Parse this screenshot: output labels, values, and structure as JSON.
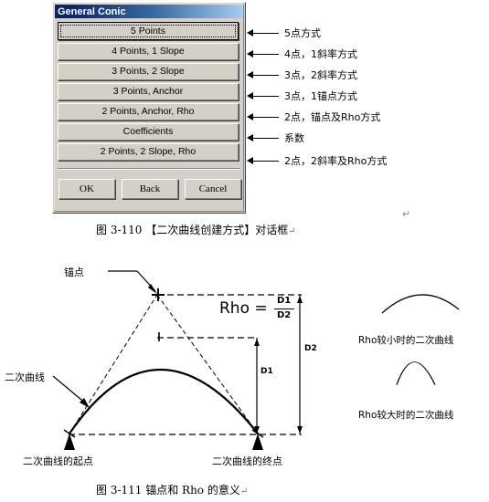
{
  "dialog": {
    "title": "General Conic",
    "options": [
      {
        "label": "5 Points",
        "selected": true
      },
      {
        "label": "4 Points, 1 Slope",
        "selected": false
      },
      {
        "label": "3 Points, 2 Slope",
        "selected": false
      },
      {
        "label": "3 Points, Anchor",
        "selected": false
      },
      {
        "label": "2 Points, Anchor, Rho",
        "selected": false
      },
      {
        "label": "Coefficients",
        "selected": false
      },
      {
        "label": "2 Points, 2 Slope, Rho",
        "selected": false
      }
    ],
    "actions": [
      {
        "label": "OK"
      },
      {
        "label": "Back"
      },
      {
        "label": "Cancel"
      }
    ]
  },
  "annotations": [
    {
      "text": "5点方式"
    },
    {
      "text": "4点，1斜率方式"
    },
    {
      "text": "3点，2斜率方式"
    },
    {
      "text": "3点，1锚点方式"
    },
    {
      "text": "2点，锚点及Rho方式"
    },
    {
      "text": "系数"
    },
    {
      "text": "2点，2斜率及Rho方式"
    }
  ],
  "captions": {
    "figure_3_110": "图 3-110  【二次曲线创建方式】对话框",
    "figure_3_111": "图 3-111   锚点和 Rho 的意义",
    "pilcrow": "↵"
  },
  "diagram": {
    "anchor_label": "锚点",
    "curve_label": "二次曲线",
    "start_label": "二次曲线的起点",
    "end_label": "二次曲线的终点",
    "dim_d1": "D1",
    "dim_d2": "D2",
    "rho_lhs": "Rho =",
    "rho_numerator": "D1",
    "rho_denominator": "D2"
  },
  "side_examples": [
    {
      "caption": "Rho较小时的二次曲线"
    },
    {
      "caption": "Rho较大时的二次曲线"
    }
  ],
  "colors": {
    "dialog_face": "#d4d0c8",
    "titlebar_start": "#0a246a",
    "titlebar_end": "#a6caf0",
    "page_background": "#ffffff",
    "ink": "#000000"
  }
}
